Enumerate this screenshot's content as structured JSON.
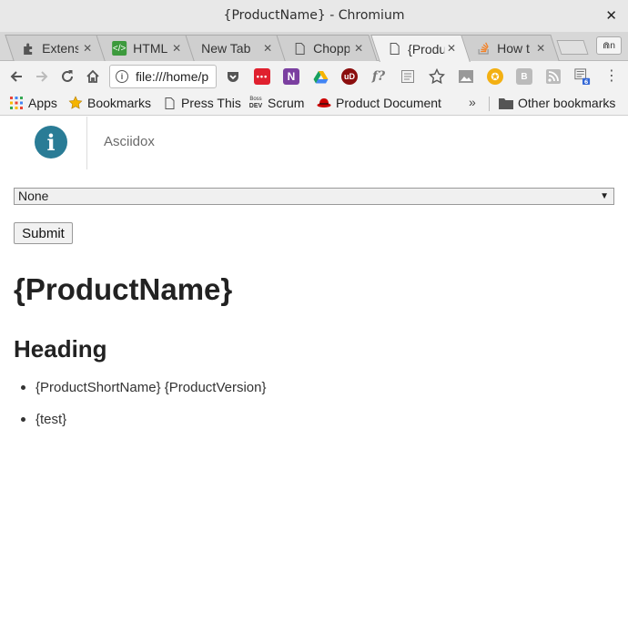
{
  "window": {
    "title": "{ProductName} - Chromium",
    "close_glyph": "✕"
  },
  "tabs": [
    {
      "label": "Extens",
      "icon": "puzzle-icon"
    },
    {
      "label": "HTML",
      "icon": "html-icon"
    },
    {
      "label": "New Tab",
      "icon": ""
    },
    {
      "label": "Chopp",
      "icon": "page-icon"
    },
    {
      "label": "{Produ",
      "icon": "page-icon",
      "active": true
    },
    {
      "label": "How t",
      "icon": "stackoverflow-icon"
    }
  ],
  "toolbar": {
    "url": "file:///home/p",
    "profile_label": "⋒n"
  },
  "bookmarks": [
    {
      "label": "Apps",
      "icon": "apps-grid-icon"
    },
    {
      "label": "Bookmarks",
      "icon": "star-icon"
    },
    {
      "label": "Press This",
      "icon": "page-icon"
    },
    {
      "label": "Scrum",
      "icon": "dev-icon"
    },
    {
      "label": "Product Document",
      "icon": "redhat-icon"
    },
    {
      "label": "Other bookmarks",
      "icon": "folder-icon"
    }
  ],
  "bookmarks_overflow": "»",
  "page": {
    "brand": "Asciidox",
    "logo_glyph": "i",
    "select_value": "None",
    "submit_label": "Submit",
    "h1": "{ProductName}",
    "h2": "Heading",
    "list": [
      "{ProductShortName} {ProductVersion}",
      "{test}"
    ]
  },
  "colors": {
    "logo": "#2a7c96",
    "titlebar": "#e8e8e8",
    "toolbar": "#f2f2f2"
  }
}
